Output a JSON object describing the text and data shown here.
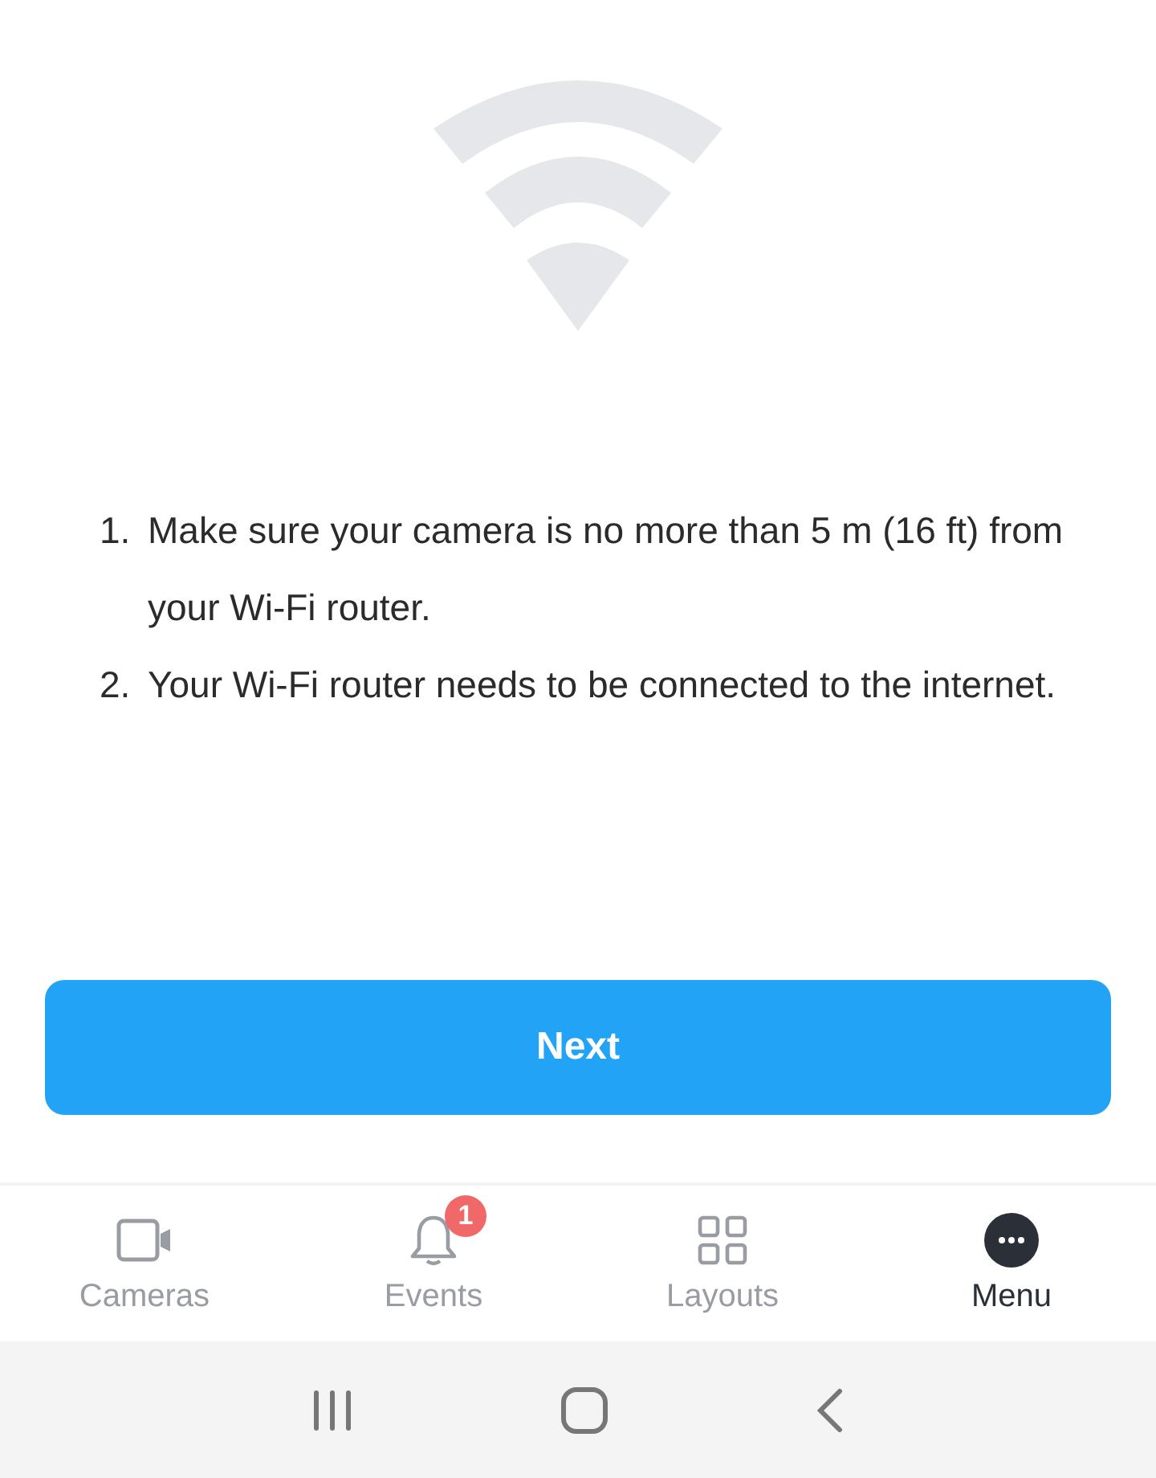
{
  "steps": [
    {
      "number": "1.",
      "text": "Make sure your camera is no more than 5 m (16 ft) from your Wi-Fi router."
    },
    {
      "number": "2.",
      "text": "Your Wi-Fi router needs to be connected to the internet."
    }
  ],
  "next_button": {
    "label": "Next"
  },
  "tab_bar": [
    {
      "kind": "camera",
      "label": "Cameras",
      "selected": false
    },
    {
      "kind": "bell",
      "label": "Events",
      "selected": false,
      "badge": "1"
    },
    {
      "kind": "grid",
      "label": "Layouts",
      "selected": false
    },
    {
      "kind": "more",
      "label": "Menu",
      "selected": true
    }
  ]
}
